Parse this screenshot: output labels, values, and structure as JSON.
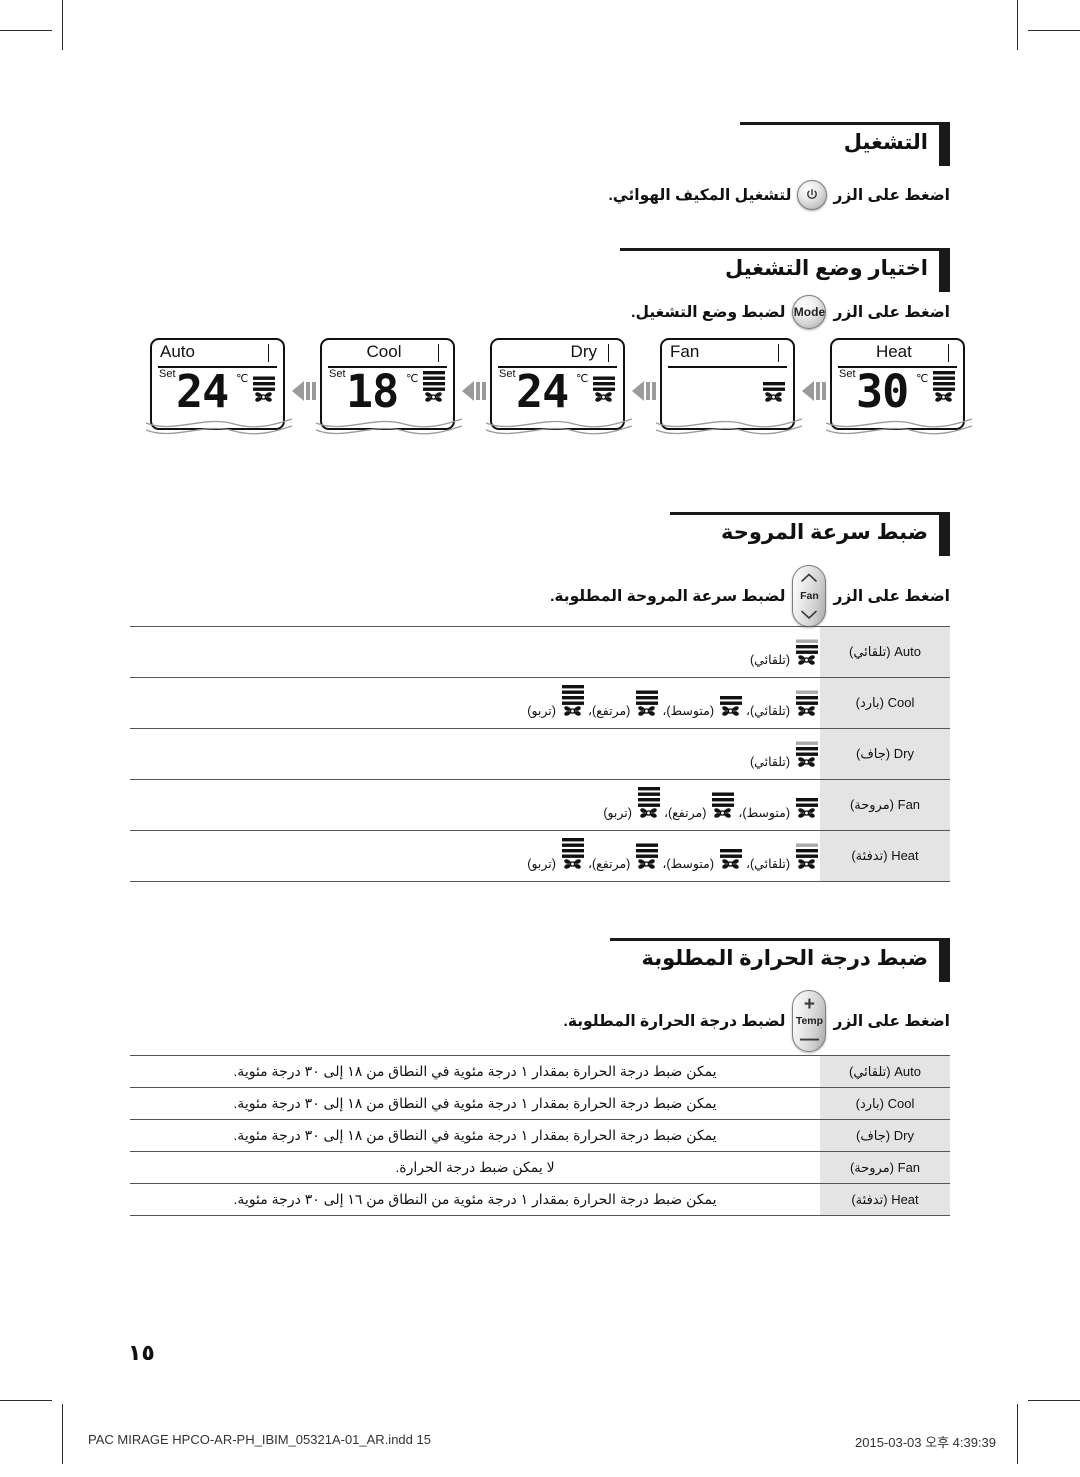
{
  "sections": {
    "operation": {
      "title": "التشغيل",
      "instruction_before": "اضغط على الزر",
      "instruction_after": "لتشغيل المكيف الهوائي.",
      "button_icon": "power-icon"
    },
    "mode": {
      "title": "اختيار وضع التشغيل",
      "instruction_before": "اضغط على الزر",
      "instruction_after": "لضبط وضع التشغيل.",
      "button_label": "Mode"
    },
    "fan_speed": {
      "title": "ضبط سرعة المروحة",
      "instruction_before": "اضغط على الزر",
      "instruction_after": "لضبط سرعة المروحة المطلوبة.",
      "button_label": "Fan"
    },
    "temperature": {
      "title": "ضبط درجة الحرارة المطلوبة",
      "instruction_before": "اضغط على الزر",
      "instruction_after": "لضبط درجة الحرارة المطلوبة.",
      "button_label": "Temp",
      "plus": "+",
      "minus": "—"
    }
  },
  "lcd_panels": [
    {
      "mode": "Auto",
      "mode_align": "left",
      "set_label": "Set",
      "temp": "24",
      "unit": "℃",
      "fan_bars": 3,
      "has_temp": true
    },
    {
      "mode": "Cool",
      "mode_align": "center",
      "set_label": "Set",
      "temp": "18",
      "unit": "℃",
      "fan_bars": 4,
      "has_temp": true
    },
    {
      "mode": "Dry",
      "mode_align": "right",
      "set_label": "Set",
      "temp": "24",
      "unit": "℃",
      "fan_bars": 3,
      "has_temp": true
    },
    {
      "mode": "Fan",
      "mode_align": "left",
      "set_label": "",
      "temp": "",
      "unit": "",
      "fan_bars": 2,
      "has_temp": false
    },
    {
      "mode": "Heat",
      "mode_align": "center",
      "set_label": "Set",
      "temp": "30",
      "unit": "℃",
      "fan_bars": 4,
      "has_temp": true
    }
  ],
  "fan_speed_table": {
    "rows": [
      {
        "mode_ar": "(تلقائي)",
        "mode_en": "Auto",
        "options": [
          {
            "label": "(تلقائي)",
            "bars": 3,
            "auto": true
          }
        ]
      },
      {
        "mode_ar": "(بارد)",
        "mode_en": "Cool",
        "options": [
          {
            "label": "(تلقائي)",
            "bars": 3,
            "auto": true
          },
          {
            "label": "(متوسط)",
            "bars": 2,
            "auto": false
          },
          {
            "label": "(مرتفع)",
            "bars": 3,
            "auto": false
          },
          {
            "label": "(تربو)",
            "bars": 4,
            "auto": false
          }
        ]
      },
      {
        "mode_ar": "(جاف)",
        "mode_en": "Dry",
        "options": [
          {
            "label": "(تلقائي)",
            "bars": 3,
            "auto": true
          }
        ]
      },
      {
        "mode_ar": "(مروحة)",
        "mode_en": "Fan",
        "options": [
          {
            "label": "(متوسط)",
            "bars": 2,
            "auto": false
          },
          {
            "label": "(مرتفع)",
            "bars": 3,
            "auto": false
          },
          {
            "label": "(تربو)",
            "bars": 4,
            "auto": false
          }
        ]
      },
      {
        "mode_ar": "(تدفئة)",
        "mode_en": "Heat",
        "options": [
          {
            "label": "(تلقائي)",
            "bars": 3,
            "auto": true
          },
          {
            "label": "(متوسط)",
            "bars": 2,
            "auto": false
          },
          {
            "label": "(مرتفع)",
            "bars": 3,
            "auto": false
          },
          {
            "label": "(تربو)",
            "bars": 4,
            "auto": false
          }
        ]
      }
    ]
  },
  "temperature_table": {
    "rows": [
      {
        "mode_ar": "(تلقائي)",
        "mode_en": "Auto",
        "text": "يمكن ضبط درجة الحرارة بمقدار ١ درجة مئوية في النطاق من ١٨ إلى ٣٠ درجة مئوية."
      },
      {
        "mode_ar": "(بارد)",
        "mode_en": "Cool",
        "text": "يمكن ضبط درجة الحرارة بمقدار ١ درجة مئوية في النطاق من ١٨ إلى ٣٠ درجة مئوية."
      },
      {
        "mode_ar": "(جاف)",
        "mode_en": "Dry",
        "text": "يمكن ضبط درجة الحرارة بمقدار ١ درجة مئوية في النطاق من ١٨ إلى ٣٠ درجة مئوية."
      },
      {
        "mode_ar": "(مروحة)",
        "mode_en": "Fan",
        "text": "لا يمكن ضبط درجة الحرارة."
      },
      {
        "mode_ar": "(تدفئة)",
        "mode_en": "Heat",
        "text": "يمكن ضبط درجة الحرارة بمقدار ١ درجة مئوية من النطاق من ١٦ إلى ٣٠ درجة مئوية."
      }
    ]
  },
  "page_number": "١٥",
  "footer": {
    "left": "PAC MIRAGE HPCO-AR-PH_IBIM_05321A-01_AR.indd   15",
    "right": "2015-03-03   오후 4:39:39"
  }
}
